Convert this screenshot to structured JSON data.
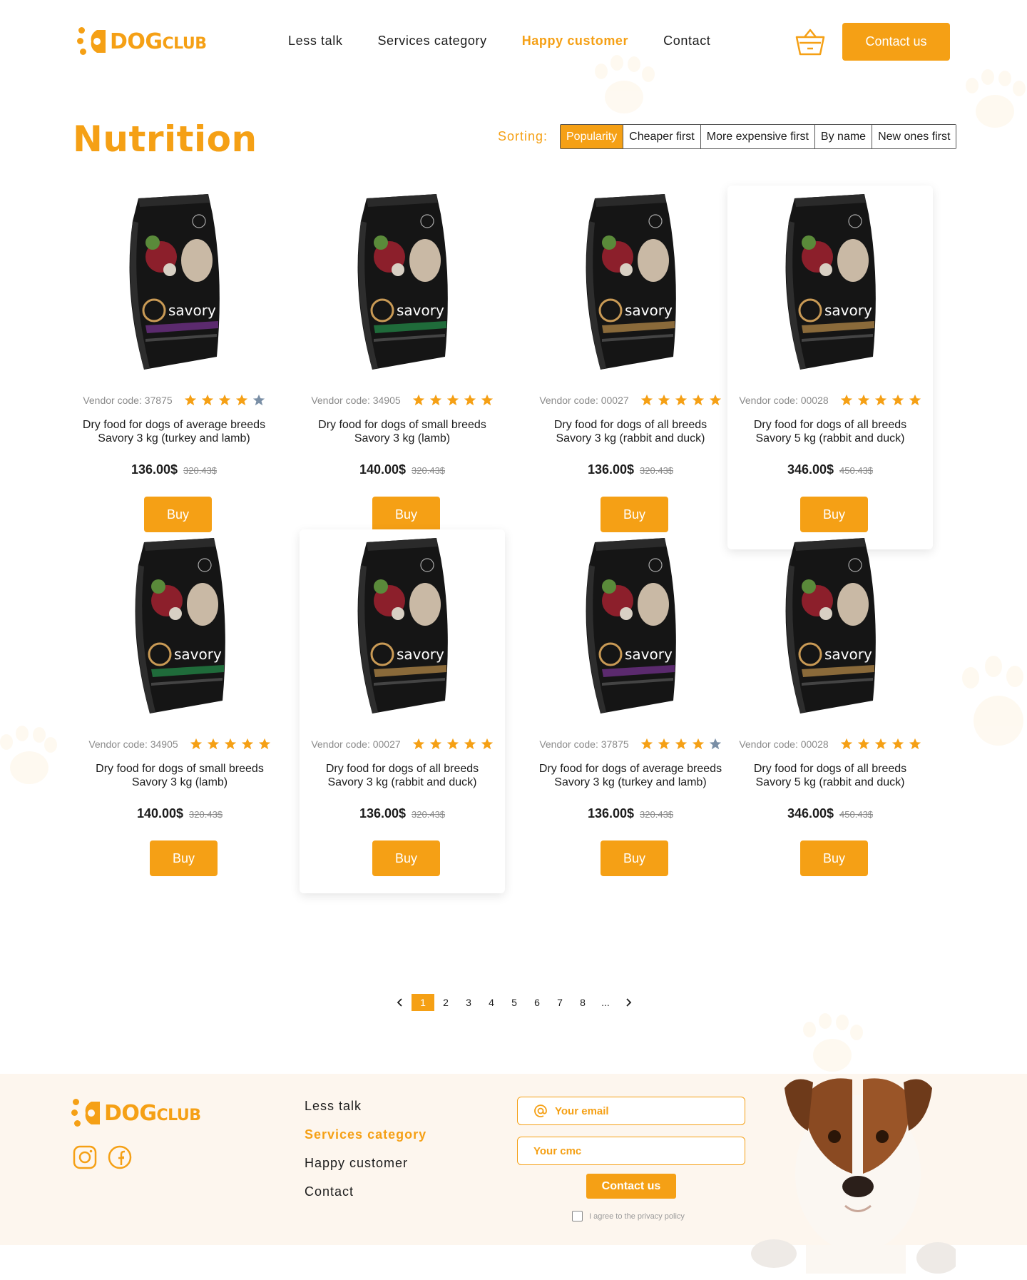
{
  "brand": {
    "logo_big": "DOG",
    "logo_small": "CLUB"
  },
  "nav": [
    {
      "label": "Less talk",
      "active": false
    },
    {
      "label": "Services category",
      "active": false
    },
    {
      "label": "Happy customer",
      "active": true
    },
    {
      "label": "Contact",
      "active": false
    }
  ],
  "header": {
    "cart_icon": "basket-icon",
    "contact_label": "Contact us"
  },
  "page": {
    "title": "Nutrition",
    "sorting_label": "Sorting:"
  },
  "sorting": [
    {
      "label": "Popularity",
      "active": true
    },
    {
      "label": "Cheaper first",
      "active": false
    },
    {
      "label": "More expensive first",
      "active": false
    },
    {
      "label": "By name",
      "active": false
    },
    {
      "label": "New ones first",
      "active": false
    }
  ],
  "products": [
    {
      "vendor": "Vendor code: 37875",
      "rating": 4,
      "name_line1": "Dry food for dogs of average breeds",
      "name_line2": "Savory 3 kg (turkey and lamb)",
      "price": "136.00$",
      "old_price": "320.43$",
      "buy": "Buy",
      "label_color": "#5b2a6e",
      "highlighted": false
    },
    {
      "vendor": "Vendor code: 34905",
      "rating": 5,
      "name_line1": "Dry food for dogs of small breeds",
      "name_line2": "Savory 3 kg (lamb)",
      "price": "140.00$",
      "old_price": "320.43$",
      "buy": "Buy",
      "label_color": "#1f6b3a",
      "highlighted": false
    },
    {
      "vendor": "Vendor code: 00027",
      "rating": 5,
      "name_line1": "Dry food for dogs of all breeds",
      "name_line2": "Savory 3 kg (rabbit and duck)",
      "price": "136.00$",
      "old_price": "320.43$",
      "buy": "Buy",
      "label_color": "#8a6a3a",
      "highlighted": false
    },
    {
      "vendor": "Vendor code: 00028",
      "rating": 5,
      "name_line1": "Dry food for dogs of all breeds",
      "name_line2": "Savory 5 kg (rabbit and duck)",
      "price": "346.00$",
      "old_price": "450.43$",
      "buy": "Buy",
      "label_color": "#8a6a3a",
      "highlighted": true
    },
    {
      "vendor": "Vendor code: 34905",
      "rating": 5,
      "name_line1": "Dry food for dogs of small breeds",
      "name_line2": "Savory 3 kg (lamb)",
      "price": "140.00$",
      "old_price": "320.43$",
      "buy": "Buy",
      "label_color": "#1f6b3a",
      "highlighted": false
    },
    {
      "vendor": "Vendor code: 00027",
      "rating": 5,
      "name_line1": "Dry food for dogs of all breeds",
      "name_line2": "Savory 3 kg (rabbit and duck)",
      "price": "136.00$",
      "old_price": "320.43$",
      "buy": "Buy",
      "label_color": "#8a6a3a",
      "highlighted": true
    },
    {
      "vendor": "Vendor code: 37875",
      "rating": 4,
      "name_line1": "Dry food for dogs of average breeds",
      "name_line2": "Savory 3 kg (turkey and lamb)",
      "price": "136.00$",
      "old_price": "320.43$",
      "buy": "Buy",
      "label_color": "#5b2a6e",
      "highlighted": false
    },
    {
      "vendor": "Vendor code: 00028",
      "rating": 5,
      "name_line1": "Dry food for dogs of all breeds",
      "name_line2": "Savory 5 kg (rabbit and duck)",
      "price": "346.00$",
      "old_price": "450.43$",
      "buy": "Buy",
      "label_color": "#8a6a3a",
      "highlighted": false
    }
  ],
  "pagination": {
    "pages": [
      "1",
      "2",
      "3",
      "4",
      "5",
      "6",
      "7",
      "8",
      "..."
    ],
    "current": "1"
  },
  "footer": {
    "nav": [
      {
        "label": "Less talk",
        "active": false
      },
      {
        "label": "Services category",
        "active": true
      },
      {
        "label": "Happy customer",
        "active": false
      },
      {
        "label": "Contact",
        "active": false
      }
    ],
    "email_placeholder": "Your email",
    "sms_placeholder": "Your cmc",
    "contact_label": "Contact us",
    "agree_text": "I agree to the privacy policy",
    "social_icons": [
      "instagram-icon",
      "facebook-icon"
    ]
  },
  "colors": {
    "accent": "#f5a015",
    "footer_bg": "#fdf6ee",
    "star_off": "#7a8fa6",
    "text": "#1c1c1c",
    "muted": "#8a8a8a"
  }
}
